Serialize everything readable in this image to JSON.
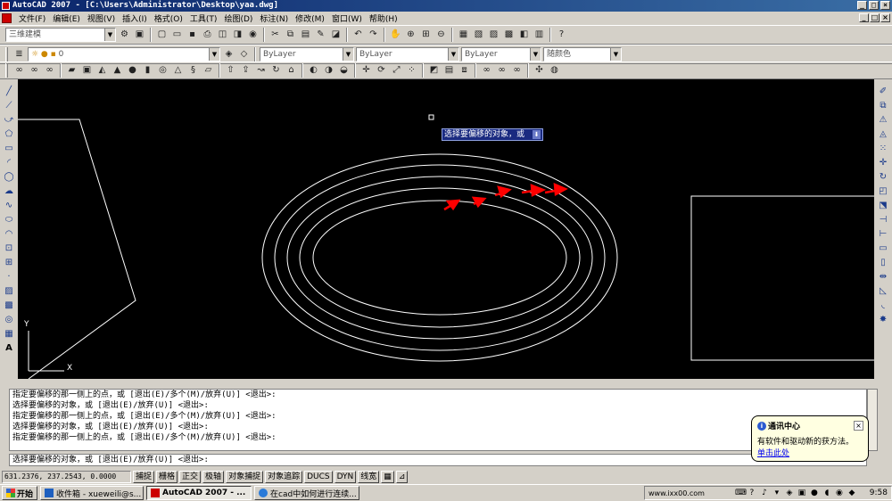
{
  "window": {
    "title": "AutoCAD 2007 - [C:\\Users\\Administrator\\Desktop\\yaa.dwg]",
    "controls": [
      "_",
      "□",
      "×"
    ]
  },
  "menu": [
    "文件(F)",
    "编辑(E)",
    "视图(V)",
    "插入(I)",
    "格式(O)",
    "工具(T)",
    "绘图(D)",
    "标注(N)",
    "修改(M)",
    "窗口(W)",
    "帮助(H)"
  ],
  "toolbar1": {
    "workspace": "三维建模"
  },
  "toolbar2": {
    "layer": "0",
    "color": "ByLayer",
    "linetype": "ByLayer",
    "lineweight": "ByLayer",
    "plotstyle": "随颜色"
  },
  "icons": {
    "left_toolbar": [
      "line-icon",
      "xline-icon",
      "pline-icon",
      "polygon-icon",
      "rectangle-icon",
      "arc-icon",
      "circle-icon",
      "revcloud-icon",
      "spline-icon",
      "ellipse-icon",
      "ellipse-arc-icon",
      "insert-block-icon",
      "make-block-icon",
      "point-icon",
      "hatch-icon",
      "gradient-icon",
      "region-icon",
      "table-icon",
      "mtext-icon"
    ],
    "right_toolbar": [
      "erase-icon",
      "copy-icon",
      "mirror-icon",
      "offset-icon",
      "array-icon",
      "move-icon",
      "rotate-icon",
      "scale-icon",
      "stretch-icon",
      "trim-icon",
      "extend-icon",
      "break-point-icon",
      "break-icon",
      "join-icon",
      "chamfer-icon",
      "fillet-icon",
      "explode-icon"
    ]
  },
  "canvas": {
    "tooltip": "选择要偏移的对象，或",
    "ucs_x": "X",
    "ucs_y": "Y",
    "arrow_color": "#ff0000",
    "line_color": "#ffffff",
    "background": "#000000"
  },
  "command": {
    "history": [
      "指定要偏移的那一侧上的点，或 [退出(E)/多个(M)/放弃(U)] <退出>:",
      "选择要偏移的对象，或 [退出(E)/放弃(U)] <退出>:",
      "指定要偏移的那一侧上的点，或 [退出(E)/多个(M)/放弃(U)] <退出>:",
      "选择要偏移的对象，或 [退出(E)/放弃(U)] <退出>:",
      "指定要偏移的那一侧上的点，或 [退出(E)/多个(M)/放弃(U)] <退出>:"
    ],
    "current": "选择要偏移的对象，或 [退出(E)/放弃(U)] <退出>:"
  },
  "balloon": {
    "title": "通讯中心",
    "text": "有软件和驱动新的获方法。",
    "link": "单击此处"
  },
  "status": {
    "coords": "631.2376, 237.2543, 0.0000",
    "buttons": [
      "捕捉",
      "栅格",
      "正交",
      "极轴",
      "对象捕捉",
      "对象追踪",
      "DUCS",
      "DYN",
      "线宽"
    ]
  },
  "taskbar": {
    "start": "开始",
    "tasks": [
      {
        "label": "收件箱 - xueweili@s...",
        "active": false
      },
      {
        "label": "AutoCAD 2007 - ...",
        "active": true
      },
      {
        "label": "在cad中如何进行连续...",
        "active": false
      }
    ],
    "url": "www.ixx00.com",
    "clock": "9:58"
  }
}
